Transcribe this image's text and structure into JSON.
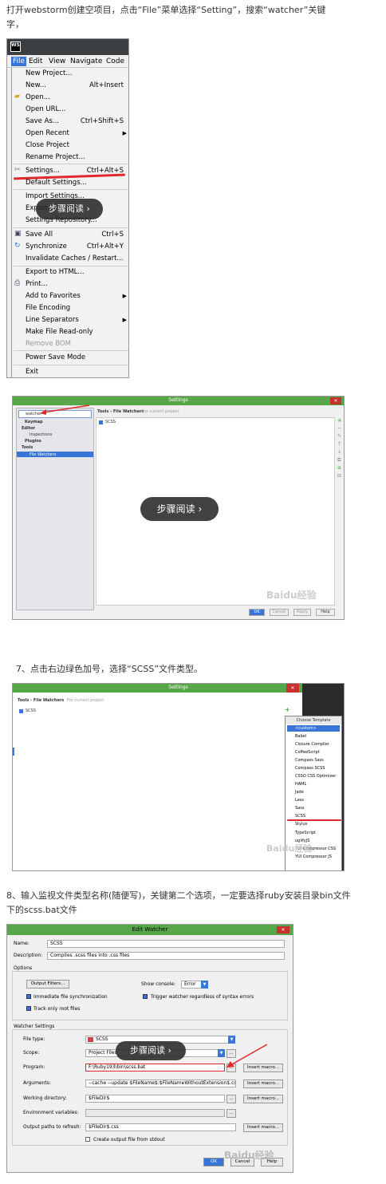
{
  "intro_line1": "打开webstorm创建空项目，点击“File”菜单选择“Setting”，搜索“watcher”关键",
  "intro_line2": "字，",
  "step7": "7、点击右边绿色加号，选择“SCSS”文件类型。",
  "step8_line1": "8、输入监视文件类型名称(随便写)，关键第二个选项，一定要选择ruby安装目录bin文件",
  "step8_line2": "下的scss.bat文件",
  "overlay_text": "步骤阅读",
  "watermark": "Baidu经验",
  "shot1": {
    "app_icon": "WS",
    "menubar": [
      "File",
      "Edit",
      "View",
      "Navigate",
      "Code"
    ],
    "items": [
      {
        "label": "New Project...",
        "shortcut": ""
      },
      {
        "label": "New...",
        "shortcut": "Alt+Insert"
      },
      {
        "label": "Open...",
        "shortcut": ""
      },
      {
        "label": "Open URL...",
        "shortcut": ""
      },
      {
        "label": "Save As...",
        "shortcut": "Ctrl+Shift+S"
      },
      {
        "label": "Open Recent",
        "shortcut": ""
      },
      {
        "label": "Close Project",
        "shortcut": ""
      },
      {
        "label": "Rename Project...",
        "shortcut": ""
      },
      {
        "label": "Settings...",
        "shortcut": "Ctrl+Alt+S"
      },
      {
        "label": "Default Settings...",
        "shortcut": ""
      },
      {
        "label": "Import Settings...",
        "shortcut": ""
      },
      {
        "label": "Export Settings...",
        "shortcut": ""
      },
      {
        "label": "Settings Repository...",
        "shortcut": ""
      },
      {
        "label": "Save All",
        "shortcut": "Ctrl+S"
      },
      {
        "label": "Synchronize",
        "shortcut": "Ctrl+Alt+Y"
      },
      {
        "label": "Invalidate Caches / Restart...",
        "shortcut": ""
      },
      {
        "label": "Export to HTML...",
        "shortcut": ""
      },
      {
        "label": "Print...",
        "shortcut": ""
      },
      {
        "label": "Add to Favorites",
        "shortcut": ""
      },
      {
        "label": "File Encoding",
        "shortcut": ""
      },
      {
        "label": "Line Separators",
        "shortcut": ""
      },
      {
        "label": "Make File Read-only",
        "shortcut": ""
      },
      {
        "label": "Remove BOM",
        "shortcut": ""
      },
      {
        "label": "Power Save Mode",
        "shortcut": ""
      },
      {
        "label": "Exit",
        "shortcut": ""
      }
    ]
  },
  "shot2": {
    "title": "Settings",
    "search_value": "watcher",
    "tree": [
      "Keymap",
      "Editor",
      "Inspections",
      "Plugins",
      "Tools",
      "File Watchers"
    ],
    "breadcrumb": "Tools › File Watchers",
    "breadcrumb_note": "For current project",
    "row": "SCSS",
    "buttons": [
      "OK",
      "Cancel",
      "Apply",
      "Help"
    ]
  },
  "shot3": {
    "title": "Settings",
    "breadcrumb": "Tools › File Watchers",
    "breadcrumb_note": "For current project",
    "row": "SCSS",
    "template_header": "Choose Template",
    "templates": [
      "<custom>",
      "Babel",
      "Closure Compiler",
      "CoffeeScript",
      "Compass Sass",
      "Compass SCSS",
      "CSSO CSS Optimizer",
      "HAML",
      "Jade",
      "Less",
      "Sass",
      "SCSS",
      "Stylus",
      "TypeScript",
      "uglifyJS",
      "YUI Compressor CSS",
      "YUI Compressor JS"
    ]
  },
  "shot4": {
    "title": "Edit Watcher",
    "name_label": "Name:",
    "name_value": "SCSS",
    "desc_label": "Description:",
    "desc_value": "Compiles .scss files into .css files",
    "options_label": "Options",
    "output_filters": "Output Filters...",
    "show_console_label": "Show console:",
    "show_console_value": "Error",
    "immediate_sync": "Immediate file synchronization",
    "trigger_watcher": "Trigger watcher regardless of syntax errors",
    "track_root": "Track only root files",
    "watcher_settings": "Watcher Settings",
    "file_type_label": "File type:",
    "file_type_value": "SCSS",
    "scope_label": "Scope:",
    "scope_value": "Project Files",
    "program_label": "Program:",
    "program_value": "F:\\Ruby193\\bin\\scss.bat",
    "arguments_label": "Arguments:",
    "arguments_value": "--cache --update $FileName$:$FileNameWithoutExtension$.css",
    "working_dir_label": "Working directory:",
    "working_dir_value": "$FileDir$",
    "env_label": "Environment variables:",
    "output_paths_label": "Output paths to refresh:",
    "output_paths_value": "$FileDir$.css",
    "create_output": "Create output file from stdout",
    "insert_macro": "Insert macro...",
    "ok": "OK",
    "cancel": "Cancel",
    "help": "Help"
  }
}
